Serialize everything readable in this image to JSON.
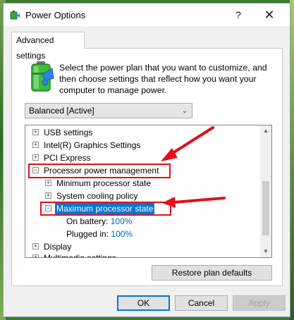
{
  "window": {
    "title": "Power Options",
    "help": "?",
    "close": "✕"
  },
  "tab": {
    "label": "Advanced settings"
  },
  "description": "Select the power plan that you want to customize, and then choose settings that reflect how you want your computer to manage power.",
  "plan": {
    "selected": "Balanced [Active]"
  },
  "tree": {
    "items": [
      {
        "label": "USB settings",
        "expander": "+"
      },
      {
        "label": "Intel(R) Graphics Settings",
        "expander": "+"
      },
      {
        "label": "PCI Express",
        "expander": "+"
      },
      {
        "label": "Processor power management",
        "expander": "−"
      },
      {
        "label": "Minimum processor state",
        "expander": "+"
      },
      {
        "label": "System cooling policy",
        "expander": "+"
      },
      {
        "label": "Maximum processor state",
        "expander": "−"
      },
      {
        "label": "On battery:",
        "value": "100%"
      },
      {
        "label": "Plugged in:",
        "value": "100%"
      },
      {
        "label": "Display",
        "expander": "+"
      },
      {
        "label": "Multimedia settings",
        "expander": "+"
      }
    ]
  },
  "buttons": {
    "restore": "Restore plan defaults",
    "ok": "OK",
    "cancel": "Cancel",
    "apply": "Apply"
  },
  "colors": {
    "accent": "#0078d7",
    "annotation": "#e0101a",
    "value": "#0066cc"
  }
}
